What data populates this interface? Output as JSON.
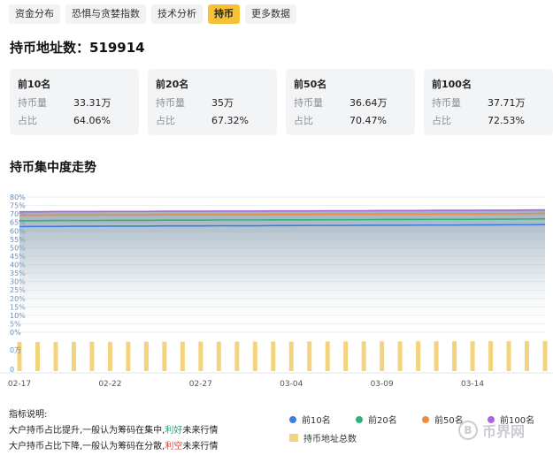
{
  "tabs": [
    {
      "label": "资金分布",
      "active": false
    },
    {
      "label": "恐惧与贪婪指数",
      "active": false
    },
    {
      "label": "技术分析",
      "active": false
    },
    {
      "label": "持币",
      "active": true
    },
    {
      "label": "更多数据",
      "active": false
    }
  ],
  "address_title": "持币地址数：519914",
  "cards": [
    {
      "title": "前10名",
      "hold_label": "持币量",
      "hold_value": "33.31万",
      "ratio_label": "占比",
      "ratio_value": "64.06%"
    },
    {
      "title": "前20名",
      "hold_label": "持币量",
      "hold_value": "35万",
      "ratio_label": "占比",
      "ratio_value": "67.32%"
    },
    {
      "title": "前50名",
      "hold_label": "持币量",
      "hold_value": "36.64万",
      "ratio_label": "占比",
      "ratio_value": "70.47%"
    },
    {
      "title": "前100名",
      "hold_label": "持币量",
      "hold_value": "37.71万",
      "ratio_label": "占比",
      "ratio_value": "72.53%"
    }
  ],
  "trend_title": "持币集中度走势",
  "notes": {
    "heading": "指标说明:",
    "line1_prefix": "大户持币占比提升,一般认为筹码在集中,",
    "line1_highlight": "利好",
    "line1_suffix": "未来行情",
    "line2_prefix": "大户持币占比下降,一般认为筹码在分散,",
    "line2_highlight": "利空",
    "line2_suffix": "未来行情"
  },
  "legend": [
    {
      "name": "前10名",
      "color": "#3b7de0"
    },
    {
      "name": "前20名",
      "color": "#2db37a"
    },
    {
      "name": "前50名",
      "color": "#f08a3c"
    },
    {
      "name": "前100名",
      "color": "#a964e0"
    },
    {
      "name": "持币地址总数",
      "color": "#f4d37e"
    }
  ],
  "watermark": {
    "icon": "B",
    "text": "币界网"
  },
  "chart_data": {
    "type": "line",
    "y_ticks": [
      "80%",
      "75%",
      "70%",
      "65%",
      "60%",
      "55%",
      "50%",
      "45%",
      "40%",
      "35%",
      "30%",
      "25%",
      "20%",
      "15%",
      "10%",
      "5%",
      "0%"
    ],
    "ylim": [
      0,
      80
    ],
    "x_ticks": [
      "02-17",
      "02-22",
      "02-27",
      "03-04",
      "03-09",
      "03-14"
    ],
    "series": [
      {
        "name": "前10名",
        "color": "#3b7de0",
        "values": [
          62.5,
          62.6,
          62.6,
          62.7,
          62.7,
          62.8,
          62.8,
          62.8,
          62.9,
          62.9,
          62.9,
          63.0,
          63.0,
          63.0,
          63.1,
          63.1,
          63.2,
          63.2,
          63.2,
          63.3,
          63.3,
          63.3,
          63.4,
          63.4,
          63.4,
          63.5,
          63.5,
          63.6,
          63.6,
          63.7
        ]
      },
      {
        "name": "前20名",
        "color": "#2db37a",
        "values": [
          66.0,
          66.0,
          66.1,
          66.1,
          66.1,
          66.2,
          66.2,
          66.2,
          66.3,
          66.3,
          66.3,
          66.4,
          66.4,
          66.4,
          66.5,
          66.5,
          66.5,
          66.6,
          66.6,
          66.6,
          66.7,
          66.7,
          66.7,
          66.8,
          66.8,
          66.8,
          66.9,
          66.9,
          67.0,
          67.1
        ]
      },
      {
        "name": "前50名",
        "color": "#f08a3c",
        "values": [
          69.2,
          69.2,
          69.3,
          69.3,
          69.3,
          69.4,
          69.4,
          69.4,
          69.5,
          69.5,
          69.5,
          69.6,
          69.6,
          69.6,
          69.7,
          69.7,
          69.7,
          69.8,
          69.8,
          69.8,
          69.9,
          69.9,
          69.9,
          70.0,
          70.0,
          70.0,
          70.1,
          70.1,
          70.2,
          70.3
        ]
      },
      {
        "name": "前100名",
        "color": "#a964e0",
        "values": [
          71.3,
          71.3,
          71.4,
          71.4,
          71.4,
          71.5,
          71.5,
          71.5,
          71.6,
          71.6,
          71.6,
          71.7,
          71.7,
          71.7,
          71.8,
          71.8,
          71.8,
          71.9,
          71.9,
          71.9,
          72.0,
          72.0,
          72.0,
          72.1,
          72.1,
          72.1,
          72.2,
          72.2,
          72.3,
          72.4
        ]
      }
    ],
    "bar_series": {
      "name": "持币地址总数",
      "color": "#f4d37e",
      "values": [
        505,
        505,
        506,
        506,
        507,
        507,
        508,
        508,
        509,
        509,
        510,
        510,
        511,
        511,
        512,
        512,
        513,
        513,
        514,
        514,
        515,
        515,
        516,
        516,
        517,
        517,
        518,
        518,
        519,
        520
      ]
    },
    "bar_y_ticks": [
      "0万",
      "0"
    ],
    "grid": true
  }
}
